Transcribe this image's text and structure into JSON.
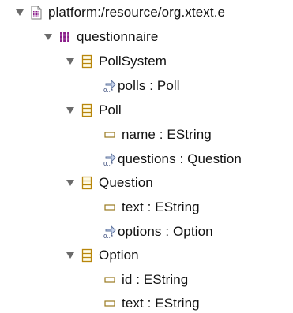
{
  "tree": {
    "resource": {
      "label": "platform:/resource/org.xtext.e",
      "icon": "resource-icon",
      "expanded": true
    },
    "package": {
      "label": "questionnaire",
      "icon": "package-icon",
      "expanded": true
    },
    "classes": [
      {
        "label": "PollSystem",
        "icon": "eclass-icon",
        "expanded": true,
        "features": [
          {
            "label": "polls : Poll",
            "icon": "reference-icon"
          }
        ]
      },
      {
        "label": "Poll",
        "icon": "eclass-icon",
        "expanded": true,
        "features": [
          {
            "label": "name : EString",
            "icon": "attribute-icon"
          },
          {
            "label": "questions : Question",
            "icon": "reference-icon"
          }
        ]
      },
      {
        "label": "Question",
        "icon": "eclass-icon",
        "expanded": true,
        "features": [
          {
            "label": "text : EString",
            "icon": "attribute-icon"
          },
          {
            "label": "options : Option",
            "icon": "reference-icon"
          }
        ]
      },
      {
        "label": "Option",
        "icon": "eclass-icon",
        "expanded": true,
        "features": [
          {
            "label": "id : EString",
            "icon": "attribute-icon"
          },
          {
            "label": "text : EString",
            "icon": "attribute-icon"
          }
        ]
      }
    ],
    "colors": {
      "package": "#8b1f8b",
      "eclass": "#b8860b",
      "reference": "#5a6f9a",
      "twisty": "#6b6b6b"
    }
  }
}
